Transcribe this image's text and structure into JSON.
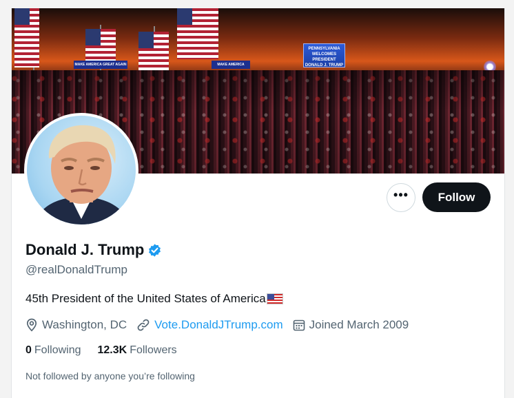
{
  "top_stub": "___ ____",
  "banner": {
    "screen_sign": "PENNSYLVANIA WELCOMES PRESIDENT DONALD J. TRUMP",
    "banner_sign_left": "MAKE AMERICA GREAT AGAIN",
    "banner_sign_right": "MAKE AMERICA GREAT AGAIN"
  },
  "profile": {
    "name": "Donald J. Trump",
    "verified_icon": "verified-badge-icon",
    "handle": "@realDonaldTrump",
    "bio": "45th President of the United States of America",
    "location": "Washington, DC",
    "website": "Vote.DonaldJTrump.com",
    "joined": "Joined March 2009",
    "following_count": "0",
    "following_label": "Following",
    "followers_count": "12.3K",
    "followers_label": "Followers",
    "mutuals_note": "Not followed by anyone you’re following"
  },
  "actions": {
    "more_label": "•••",
    "follow_label": "Follow"
  },
  "colors": {
    "accent": "#1d9bf0",
    "text_primary": "#0f1419",
    "text_secondary": "#536471",
    "follow_bg": "#0f1419"
  }
}
